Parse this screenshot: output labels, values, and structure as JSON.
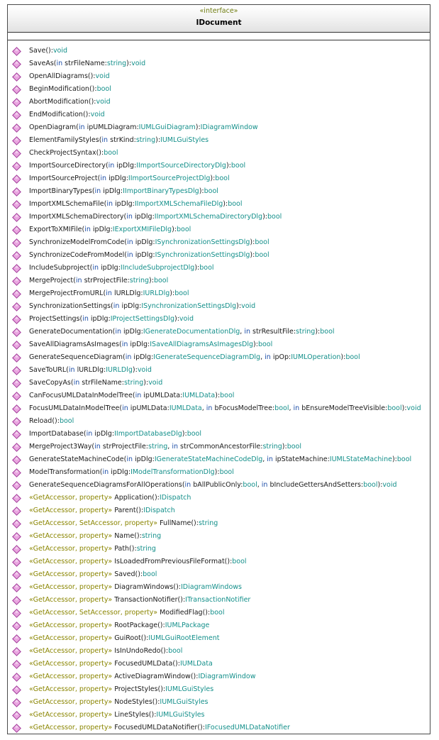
{
  "diagram": {
    "stereotype": "«interface»",
    "name": "IDocument"
  },
  "colors": {
    "border": "#4a4a4a",
    "stereotype": "#6f7d10",
    "keyword": "#1e4fa8",
    "type": "#138f8a",
    "accessor": "#8a8500",
    "icon_fill": "#e9a6e0",
    "icon_stroke": "#a23a9a"
  },
  "operations": [
    [
      [
        "Save():",
        "n"
      ],
      [
        "void",
        "t"
      ]
    ],
    [
      [
        "SaveAs(",
        "n"
      ],
      [
        "in",
        "k"
      ],
      [
        " strFileName:",
        "n"
      ],
      [
        "string",
        "t"
      ],
      [
        "):",
        "n"
      ],
      [
        "void",
        "t"
      ]
    ],
    [
      [
        "OpenAllDiagrams():",
        "n"
      ],
      [
        "void",
        "t"
      ]
    ],
    [
      [
        "BeginModification():",
        "n"
      ],
      [
        "bool",
        "t"
      ]
    ],
    [
      [
        "AbortModification():",
        "n"
      ],
      [
        "void",
        "t"
      ]
    ],
    [
      [
        "EndModification():",
        "n"
      ],
      [
        "void",
        "t"
      ]
    ],
    [
      [
        "OpenDiagram(",
        "n"
      ],
      [
        "in",
        "k"
      ],
      [
        " ipUMLDiagram:",
        "n"
      ],
      [
        "IUMLGuiDiagram",
        "t"
      ],
      [
        "):",
        "n"
      ],
      [
        "IDiagramWindow",
        "t"
      ]
    ],
    [
      [
        "ElementFamilyStyles(",
        "n"
      ],
      [
        "in",
        "k"
      ],
      [
        " strKind:",
        "n"
      ],
      [
        "string",
        "t"
      ],
      [
        "):",
        "n"
      ],
      [
        "IUMLGuiStyles",
        "t"
      ]
    ],
    [
      [
        "CheckProjectSyntax():",
        "n"
      ],
      [
        "bool",
        "t"
      ]
    ],
    [
      [
        "ImportSourceDirectory(",
        "n"
      ],
      [
        "in",
        "k"
      ],
      [
        " ipDlg:",
        "n"
      ],
      [
        "IImportSourceDirectoryDlg",
        "t"
      ],
      [
        "):",
        "n"
      ],
      [
        "bool",
        "t"
      ]
    ],
    [
      [
        "ImportSourceProject(",
        "n"
      ],
      [
        "in",
        "k"
      ],
      [
        " ipDlg:",
        "n"
      ],
      [
        "IImportSourceProjectDlg",
        "t"
      ],
      [
        "):",
        "n"
      ],
      [
        "bool",
        "t"
      ]
    ],
    [
      [
        "ImportBinaryTypes(",
        "n"
      ],
      [
        "in",
        "k"
      ],
      [
        " ipDlg:",
        "n"
      ],
      [
        "IImportBinaryTypesDlg",
        "t"
      ],
      [
        "):",
        "n"
      ],
      [
        "bool",
        "t"
      ]
    ],
    [
      [
        "ImportXMLSchemaFile(",
        "n"
      ],
      [
        "in",
        "k"
      ],
      [
        " ipDlg:",
        "n"
      ],
      [
        "IImportXMLSchemaFileDlg",
        "t"
      ],
      [
        "):",
        "n"
      ],
      [
        "bool",
        "t"
      ]
    ],
    [
      [
        "ImportXMLSchemaDirectory(",
        "n"
      ],
      [
        "in",
        "k"
      ],
      [
        " ipDlg:",
        "n"
      ],
      [
        "IImportXMLSchemaDirectoryDlg",
        "t"
      ],
      [
        "):",
        "n"
      ],
      [
        "bool",
        "t"
      ]
    ],
    [
      [
        "ExportToXMIFile(",
        "n"
      ],
      [
        "in",
        "k"
      ],
      [
        " ipDlg:",
        "n"
      ],
      [
        "IExportXMIFileDlg",
        "t"
      ],
      [
        "):",
        "n"
      ],
      [
        "bool",
        "t"
      ]
    ],
    [
      [
        "SynchronizeModelFromCode(",
        "n"
      ],
      [
        "in",
        "k"
      ],
      [
        " ipDlg:",
        "n"
      ],
      [
        "ISynchronizationSettingsDlg",
        "t"
      ],
      [
        "):",
        "n"
      ],
      [
        "bool",
        "t"
      ]
    ],
    [
      [
        "SynchronizeCodeFromModel(",
        "n"
      ],
      [
        "in",
        "k"
      ],
      [
        " ipDlg:",
        "n"
      ],
      [
        "ISynchronizationSettingsDlg",
        "t"
      ],
      [
        "):",
        "n"
      ],
      [
        "bool",
        "t"
      ]
    ],
    [
      [
        "IncludeSubproject(",
        "n"
      ],
      [
        "in",
        "k"
      ],
      [
        " ipDlg:",
        "n"
      ],
      [
        "IIncludeSubprojectDlg",
        "t"
      ],
      [
        "):",
        "n"
      ],
      [
        "bool",
        "t"
      ]
    ],
    [
      [
        "MergeProject(",
        "n"
      ],
      [
        "in",
        "k"
      ],
      [
        " strProjectFile:",
        "n"
      ],
      [
        "string",
        "t"
      ],
      [
        "):",
        "n"
      ],
      [
        "bool",
        "t"
      ]
    ],
    [
      [
        "MergeProjectFromURL(",
        "n"
      ],
      [
        "in",
        "k"
      ],
      [
        " lURLDlg:",
        "n"
      ],
      [
        "IURLDlg",
        "t"
      ],
      [
        "):",
        "n"
      ],
      [
        "bool",
        "t"
      ]
    ],
    [
      [
        "SynchronizationSettings(",
        "n"
      ],
      [
        "in",
        "k"
      ],
      [
        " ipDlg:",
        "n"
      ],
      [
        "ISynchronizationSettingsDlg",
        "t"
      ],
      [
        "):",
        "n"
      ],
      [
        "void",
        "t"
      ]
    ],
    [
      [
        "ProjectSettings(",
        "n"
      ],
      [
        "in",
        "k"
      ],
      [
        " ipDlg:",
        "n"
      ],
      [
        "IProjectSettingsDlg",
        "t"
      ],
      [
        "):",
        "n"
      ],
      [
        "void",
        "t"
      ]
    ],
    [
      [
        "GenerateDocumentation(",
        "n"
      ],
      [
        "in",
        "k"
      ],
      [
        " ipDlg:",
        "n"
      ],
      [
        "IGenerateDocumentationDlg",
        "t"
      ],
      [
        ", ",
        "n"
      ],
      [
        "in",
        "k"
      ],
      [
        " strResultFile:",
        "n"
      ],
      [
        "string",
        "t"
      ],
      [
        "):",
        "n"
      ],
      [
        "bool",
        "t"
      ]
    ],
    [
      [
        "SaveAllDiagramsAsImages(",
        "n"
      ],
      [
        "in",
        "k"
      ],
      [
        " ipDlg:",
        "n"
      ],
      [
        "ISaveAllDiagramsAsImagesDlg",
        "t"
      ],
      [
        "):",
        "n"
      ],
      [
        "bool",
        "t"
      ]
    ],
    [
      [
        "GenerateSequenceDiagram(",
        "n"
      ],
      [
        "in",
        "k"
      ],
      [
        " ipDlg:",
        "n"
      ],
      [
        "IGenerateSequenceDiagramDlg",
        "t"
      ],
      [
        ", ",
        "n"
      ],
      [
        "in",
        "k"
      ],
      [
        " ipOp:",
        "n"
      ],
      [
        "IUMLOperation",
        "t"
      ],
      [
        "):",
        "n"
      ],
      [
        "bool",
        "t"
      ]
    ],
    [
      [
        "SaveToURL(",
        "n"
      ],
      [
        "in",
        "k"
      ],
      [
        " lURLDlg:",
        "n"
      ],
      [
        "IURLDlg",
        "t"
      ],
      [
        "):",
        "n"
      ],
      [
        "void",
        "t"
      ]
    ],
    [
      [
        "SaveCopyAs(",
        "n"
      ],
      [
        "in",
        "k"
      ],
      [
        " strFileName:",
        "n"
      ],
      [
        "string",
        "t"
      ],
      [
        "):",
        "n"
      ],
      [
        "void",
        "t"
      ]
    ],
    [
      [
        "CanFocusUMLDataInModelTree(",
        "n"
      ],
      [
        "in",
        "k"
      ],
      [
        " ipUMLData:",
        "n"
      ],
      [
        "IUMLData",
        "t"
      ],
      [
        "):",
        "n"
      ],
      [
        "bool",
        "t"
      ]
    ],
    [
      [
        "FocusUMLDataInModelTree(",
        "n"
      ],
      [
        "in",
        "k"
      ],
      [
        " ipUMLData:",
        "n"
      ],
      [
        "IUMLData",
        "t"
      ],
      [
        ", ",
        "n"
      ],
      [
        "in",
        "k"
      ],
      [
        " bFocusModelTree:",
        "n"
      ],
      [
        "bool",
        "t"
      ],
      [
        ", ",
        "n"
      ],
      [
        "in",
        "k"
      ],
      [
        " bEnsureModelTreeVisible:",
        "n"
      ],
      [
        "bool",
        "t"
      ],
      [
        "):",
        "n"
      ],
      [
        "void",
        "t"
      ]
    ],
    [
      [
        "Reload():",
        "n"
      ],
      [
        "bool",
        "t"
      ]
    ],
    [
      [
        "ImportDatabase(",
        "n"
      ],
      [
        "in",
        "k"
      ],
      [
        " ipDlg:",
        "n"
      ],
      [
        "IImportDatabaseDlg",
        "t"
      ],
      [
        "):",
        "n"
      ],
      [
        "bool",
        "t"
      ]
    ],
    [
      [
        "MergeProject3Way(",
        "n"
      ],
      [
        "in",
        "k"
      ],
      [
        " strProjectFile:",
        "n"
      ],
      [
        "string",
        "t"
      ],
      [
        ", ",
        "n"
      ],
      [
        "in",
        "k"
      ],
      [
        " strCommonAncestorFile:",
        "n"
      ],
      [
        "string",
        "t"
      ],
      [
        "):",
        "n"
      ],
      [
        "bool",
        "t"
      ]
    ],
    [
      [
        "GenerateStateMachineCode(",
        "n"
      ],
      [
        "in",
        "k"
      ],
      [
        " ipDlg:",
        "n"
      ],
      [
        "IGenerateStateMachineCodeDlg",
        "t"
      ],
      [
        ", ",
        "n"
      ],
      [
        "in",
        "k"
      ],
      [
        " ipStateMachine:",
        "n"
      ],
      [
        "IUMLStateMachine",
        "t"
      ],
      [
        "):",
        "n"
      ],
      [
        "bool",
        "t"
      ]
    ],
    [
      [
        "ModelTransformation(",
        "n"
      ],
      [
        "in",
        "k"
      ],
      [
        " ipDlg:",
        "n"
      ],
      [
        "IModelTransformationDlg",
        "t"
      ],
      [
        "):",
        "n"
      ],
      [
        "bool",
        "t"
      ]
    ],
    [
      [
        "GenerateSequenceDiagramsForAllOperations(",
        "n"
      ],
      [
        "in",
        "k"
      ],
      [
        " bAllPublicOnly:",
        "n"
      ],
      [
        "bool",
        "t"
      ],
      [
        ", ",
        "n"
      ],
      [
        "in",
        "k"
      ],
      [
        " bIncludeGettersAndSetters:",
        "n"
      ],
      [
        "bool",
        "t"
      ],
      [
        "):",
        "n"
      ],
      [
        "void",
        "t"
      ]
    ],
    [
      [
        "«GetAccessor, property»",
        "s"
      ],
      [
        " Application():",
        "n"
      ],
      [
        "IDispatch",
        "t"
      ]
    ],
    [
      [
        "«GetAccessor, property»",
        "s"
      ],
      [
        " Parent():",
        "n"
      ],
      [
        "IDispatch",
        "t"
      ]
    ],
    [
      [
        "«GetAccessor, SetAccessor, property»",
        "s"
      ],
      [
        " FullName():",
        "n"
      ],
      [
        "string",
        "t"
      ]
    ],
    [
      [
        "«GetAccessor, property»",
        "s"
      ],
      [
        " Name():",
        "n"
      ],
      [
        "string",
        "t"
      ]
    ],
    [
      [
        "«GetAccessor, property»",
        "s"
      ],
      [
        " Path():",
        "n"
      ],
      [
        "string",
        "t"
      ]
    ],
    [
      [
        "«GetAccessor, property»",
        "s"
      ],
      [
        " IsLoadedFromPreviousFileFormat():",
        "n"
      ],
      [
        "bool",
        "t"
      ]
    ],
    [
      [
        "«GetAccessor, property»",
        "s"
      ],
      [
        " Saved():",
        "n"
      ],
      [
        "bool",
        "t"
      ]
    ],
    [
      [
        "«GetAccessor, property»",
        "s"
      ],
      [
        " DiagramWindows():",
        "n"
      ],
      [
        "IDiagramWindows",
        "t"
      ]
    ],
    [
      [
        "«GetAccessor, property»",
        "s"
      ],
      [
        " TransactionNotifier():",
        "n"
      ],
      [
        "ITransactionNotifier",
        "t"
      ]
    ],
    [
      [
        "«GetAccessor, SetAccessor, property»",
        "s"
      ],
      [
        " ModifiedFlag():",
        "n"
      ],
      [
        "bool",
        "t"
      ]
    ],
    [
      [
        "«GetAccessor, property»",
        "s"
      ],
      [
        " RootPackage():",
        "n"
      ],
      [
        "IUMLPackage",
        "t"
      ]
    ],
    [
      [
        "«GetAccessor, property»",
        "s"
      ],
      [
        " GuiRoot():",
        "n"
      ],
      [
        "IUMLGuiRootElement",
        "t"
      ]
    ],
    [
      [
        "«GetAccessor, property»",
        "s"
      ],
      [
        " IsInUndoRedo():",
        "n"
      ],
      [
        "bool",
        "t"
      ]
    ],
    [
      [
        "«GetAccessor, property»",
        "s"
      ],
      [
        " FocusedUMLData():",
        "n"
      ],
      [
        "IUMLData",
        "t"
      ]
    ],
    [
      [
        "«GetAccessor, property»",
        "s"
      ],
      [
        " ActiveDiagramWindow():",
        "n"
      ],
      [
        "IDiagramWindow",
        "t"
      ]
    ],
    [
      [
        "«GetAccessor, property»",
        "s"
      ],
      [
        " ProjectStyles():",
        "n"
      ],
      [
        "IUMLGuiStyles",
        "t"
      ]
    ],
    [
      [
        "«GetAccessor, property»",
        "s"
      ],
      [
        " NodeStyles():",
        "n"
      ],
      [
        "IUMLGuiStyles",
        "t"
      ]
    ],
    [
      [
        "«GetAccessor, property»",
        "s"
      ],
      [
        " LineStyles():",
        "n"
      ],
      [
        "IUMLGuiStyles",
        "t"
      ]
    ],
    [
      [
        "«GetAccessor, property»",
        "s"
      ],
      [
        " FocusedUMLDataNotifier():",
        "n"
      ],
      [
        "IFocusedUMLDataNotifier",
        "t"
      ]
    ]
  ]
}
